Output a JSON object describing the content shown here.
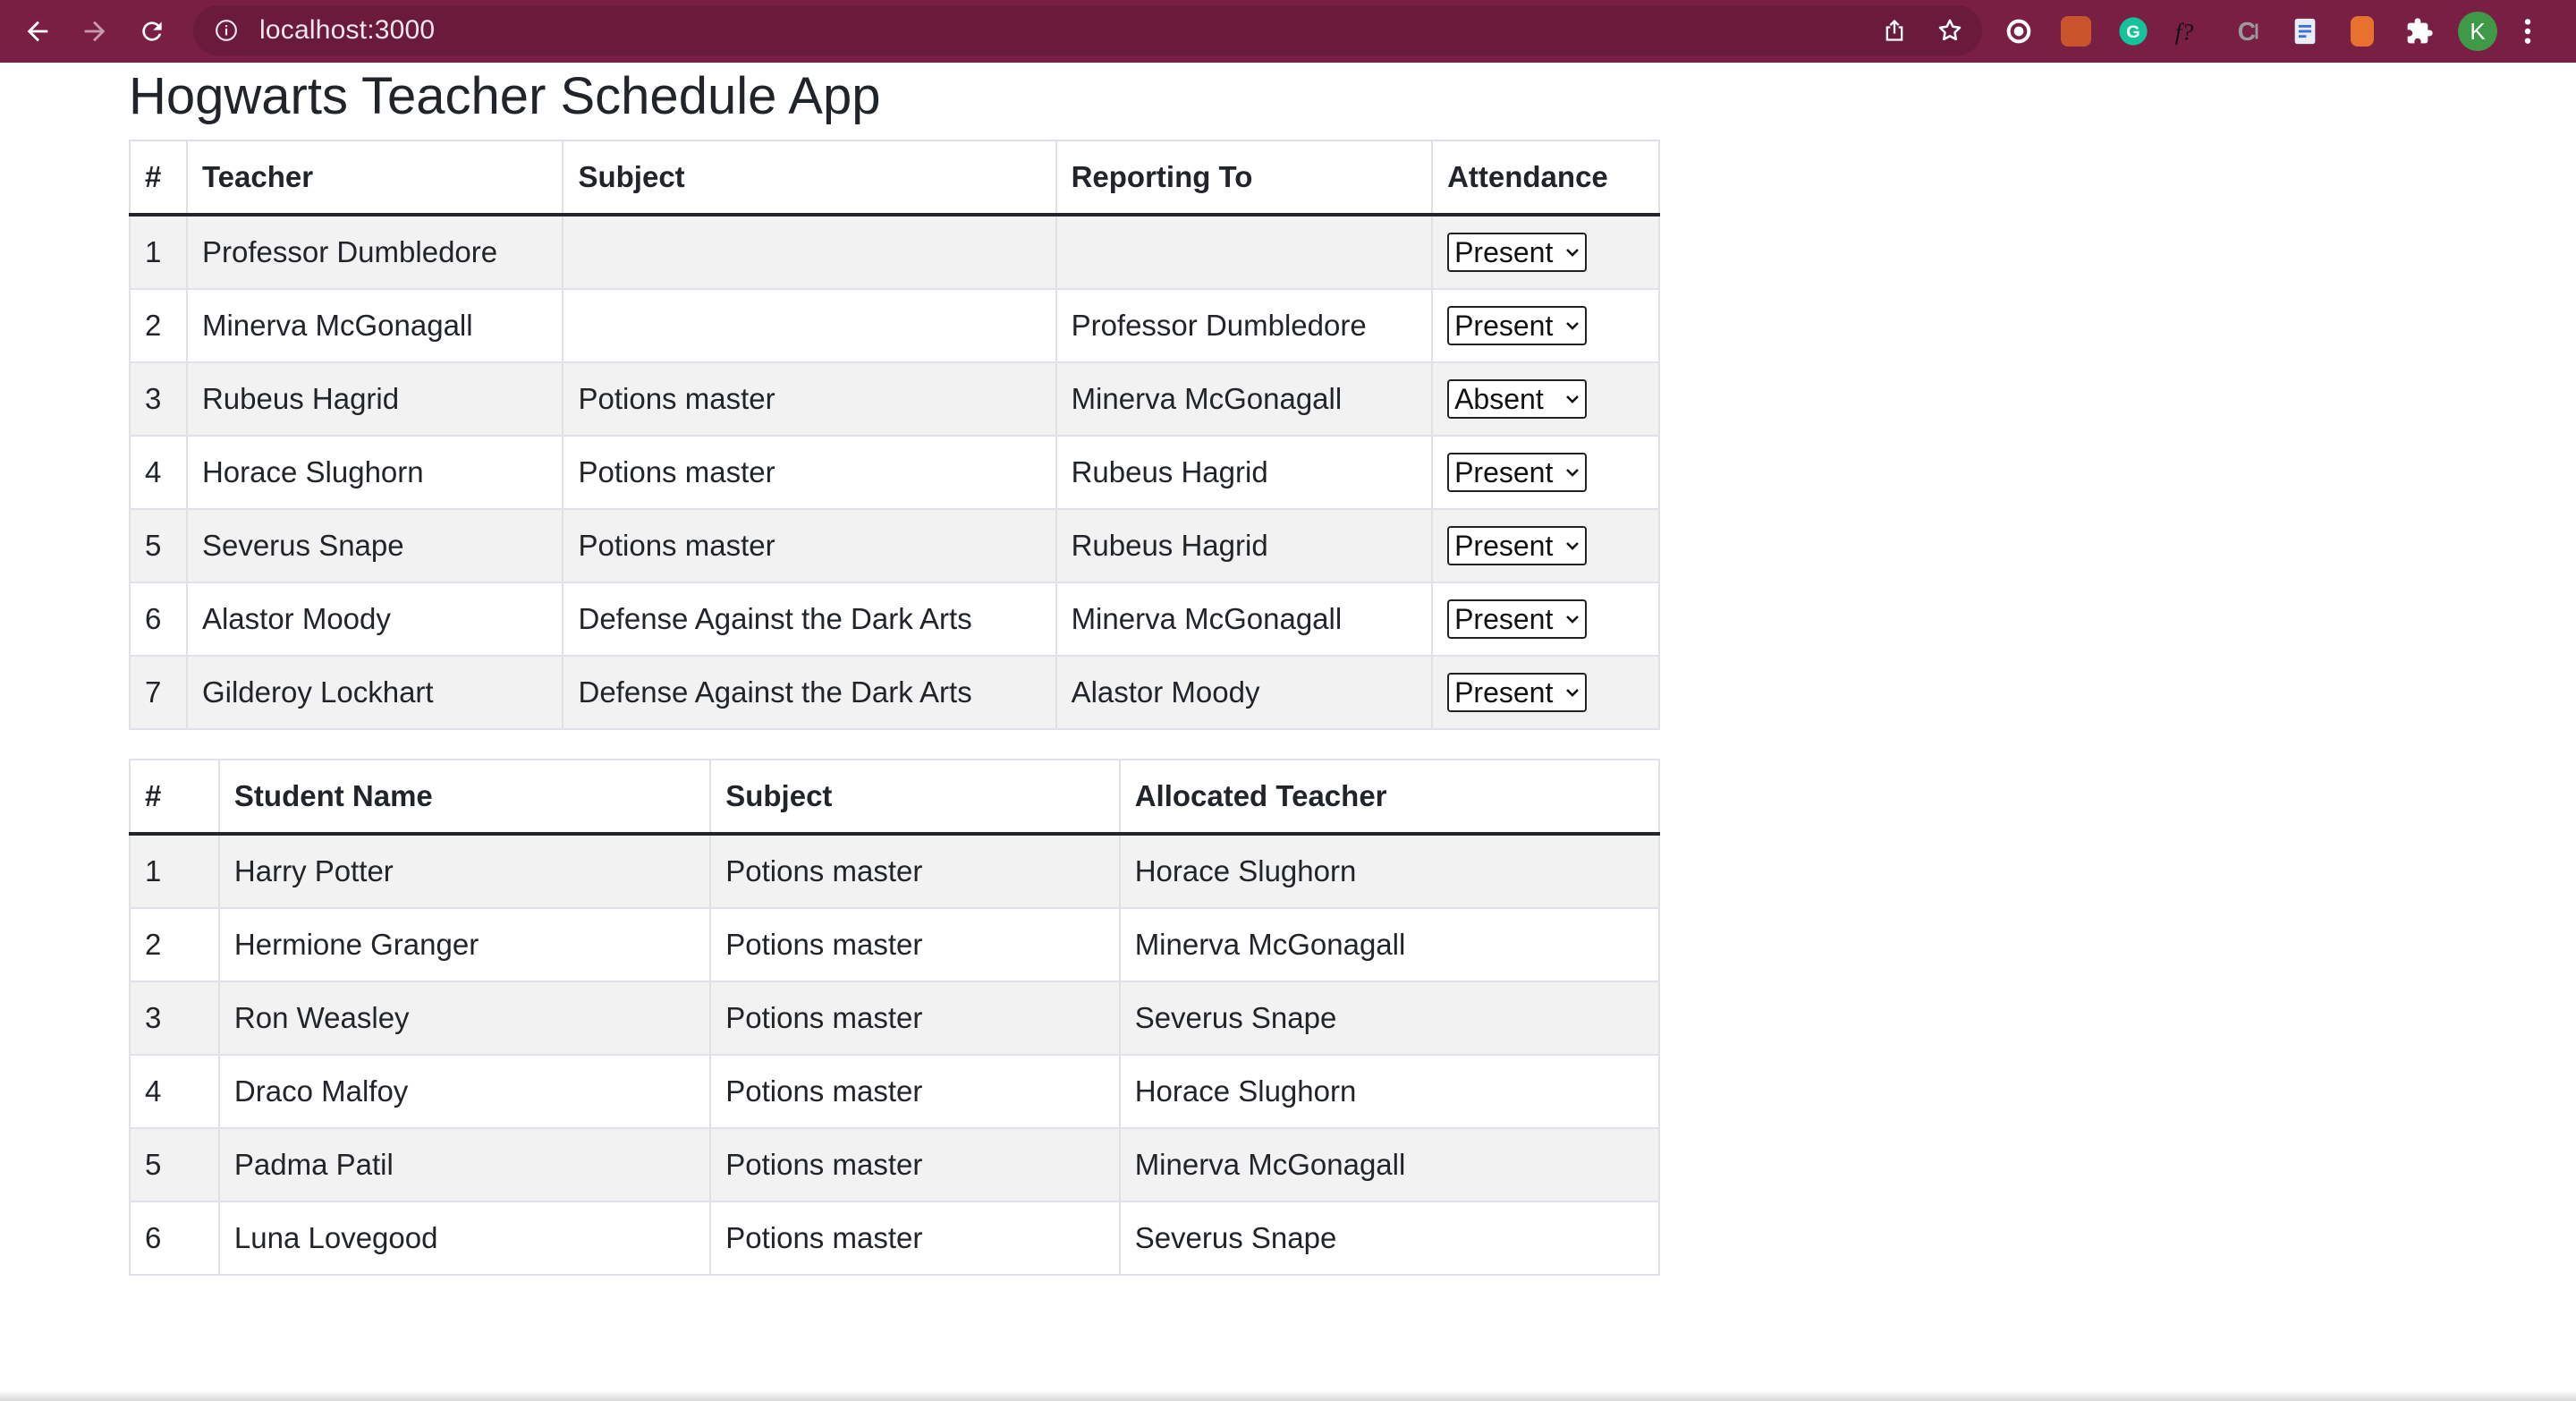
{
  "browser": {
    "url": "localhost:3000",
    "profile_initial": "K",
    "icons": {
      "back": "back-arrow-icon",
      "forward": "forward-arrow-icon",
      "reload": "reload-icon",
      "site_info": "info-icon",
      "share": "share-icon",
      "bookmark": "star-icon",
      "extensions": "puzzle-icon",
      "menu": "kebab-menu-icon"
    },
    "toolbar_color": "#7a1f44"
  },
  "page": {
    "title": "Hogwarts Teacher Schedule App"
  },
  "teachers_table": {
    "headers": [
      "#",
      "Teacher",
      "Subject",
      "Reporting To",
      "Attendance"
    ],
    "rows": [
      {
        "num": "1",
        "teacher": "Professor Dumbledore",
        "subject": "",
        "reporting_to": "",
        "attendance": "Present"
      },
      {
        "num": "2",
        "teacher": "Minerva McGonagall",
        "subject": "",
        "reporting_to": "Professor Dumbledore",
        "attendance": "Present"
      },
      {
        "num": "3",
        "teacher": "Rubeus Hagrid",
        "subject": "Potions master",
        "reporting_to": "Minerva McGonagall",
        "attendance": "Absent"
      },
      {
        "num": "4",
        "teacher": "Horace Slughorn",
        "subject": "Potions master",
        "reporting_to": "Rubeus Hagrid",
        "attendance": "Present"
      },
      {
        "num": "5",
        "teacher": "Severus Snape",
        "subject": "Potions master",
        "reporting_to": "Rubeus Hagrid",
        "attendance": "Present"
      },
      {
        "num": "6",
        "teacher": "Alastor Moody",
        "subject": "Defense Against the Dark Arts",
        "reporting_to": "Minerva McGonagall",
        "attendance": "Present"
      },
      {
        "num": "7",
        "teacher": "Gilderoy Lockhart",
        "subject": "Defense Against the Dark Arts",
        "reporting_to": "Alastor Moody",
        "attendance": "Present"
      }
    ]
  },
  "students_table": {
    "headers": [
      "#",
      "Student Name",
      "Subject",
      "Allocated Teacher"
    ],
    "rows": [
      {
        "num": "1",
        "student": "Harry Potter",
        "subject": "Potions master",
        "teacher": "Horace Slughorn"
      },
      {
        "num": "2",
        "student": "Hermione Granger",
        "subject": "Potions master",
        "teacher": "Minerva McGonagall"
      },
      {
        "num": "3",
        "student": "Ron Weasley",
        "subject": "Potions master",
        "teacher": "Severus Snape"
      },
      {
        "num": "4",
        "student": "Draco Malfoy",
        "subject": "Potions master",
        "teacher": "Horace Slughorn"
      },
      {
        "num": "5",
        "student": "Padma Patil",
        "subject": "Potions master",
        "teacher": "Minerva McGonagall"
      },
      {
        "num": "6",
        "student": "Luna Lovegood",
        "subject": "Potions master",
        "teacher": "Severus Snape"
      }
    ]
  }
}
